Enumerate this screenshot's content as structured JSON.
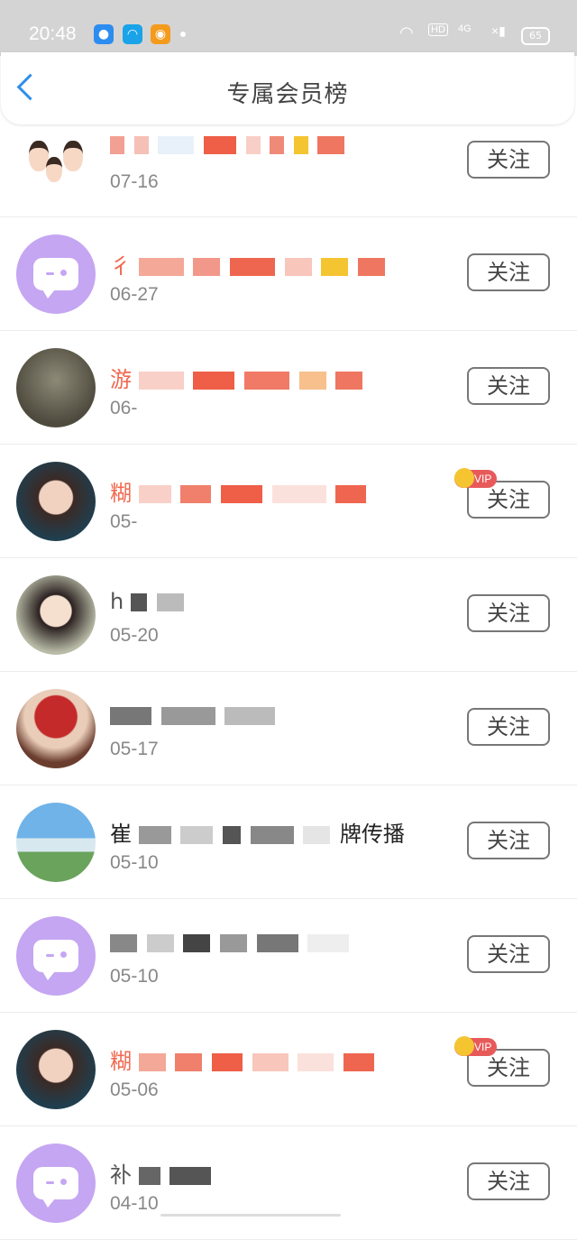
{
  "status_bar": {
    "time": "20:48",
    "signal_label": "4G",
    "hd_label": "HD",
    "battery": "65"
  },
  "header": {
    "title": "专属会员榜",
    "back_icon": "chevron-left-icon"
  },
  "colors": {
    "accent_blue": "#2f8fe8",
    "vip_red": "#e85a5a",
    "name_orange": "#f0694f",
    "avatar_purple": "#c5a6f2"
  },
  "rows": [
    {
      "name_prefix": "",
      "date": "07-16",
      "follow": "关注",
      "avatar": "cartoon-couple",
      "vip": false,
      "name_color": "orange"
    },
    {
      "name_prefix": "彳",
      "date": "06-27",
      "follow": "关注",
      "avatar": "default-chat",
      "vip": false,
      "name_color": "orange"
    },
    {
      "name_prefix": "游",
      "date": "06-",
      "follow": "关注",
      "avatar": "photo-trees",
      "vip": false,
      "name_color": "orange"
    },
    {
      "name_prefix": "糊",
      "date": "05-",
      "follow": "关注",
      "avatar": "photo-woman",
      "vip": true,
      "vip_label": "VIP",
      "name_color": "orange"
    },
    {
      "name_prefix": "h",
      "date": "05-20",
      "follow": "关注",
      "avatar": "photo-anime-girl",
      "vip": false,
      "name_color": "grey"
    },
    {
      "name_prefix": "",
      "date": "05-17",
      "follow": "关注",
      "avatar": "photo-opera",
      "vip": false,
      "name_color": "grey"
    },
    {
      "name_prefix": "崔",
      "name_suffix": "牌传播",
      "date": "05-10",
      "follow": "关注",
      "avatar": "photo-sea",
      "vip": false,
      "name_color": "black"
    },
    {
      "name_prefix": "",
      "date": "05-10",
      "follow": "关注",
      "avatar": "default-chat",
      "vip": false,
      "name_color": "grey"
    },
    {
      "name_prefix": "糊",
      "date": "05-06",
      "follow": "关注",
      "avatar": "photo-woman",
      "vip": true,
      "vip_label": "VIP",
      "name_color": "orange"
    },
    {
      "name_prefix": "补",
      "date": "04-10",
      "follow": "关注",
      "avatar": "default-chat",
      "vip": false,
      "name_color": "grey"
    }
  ]
}
